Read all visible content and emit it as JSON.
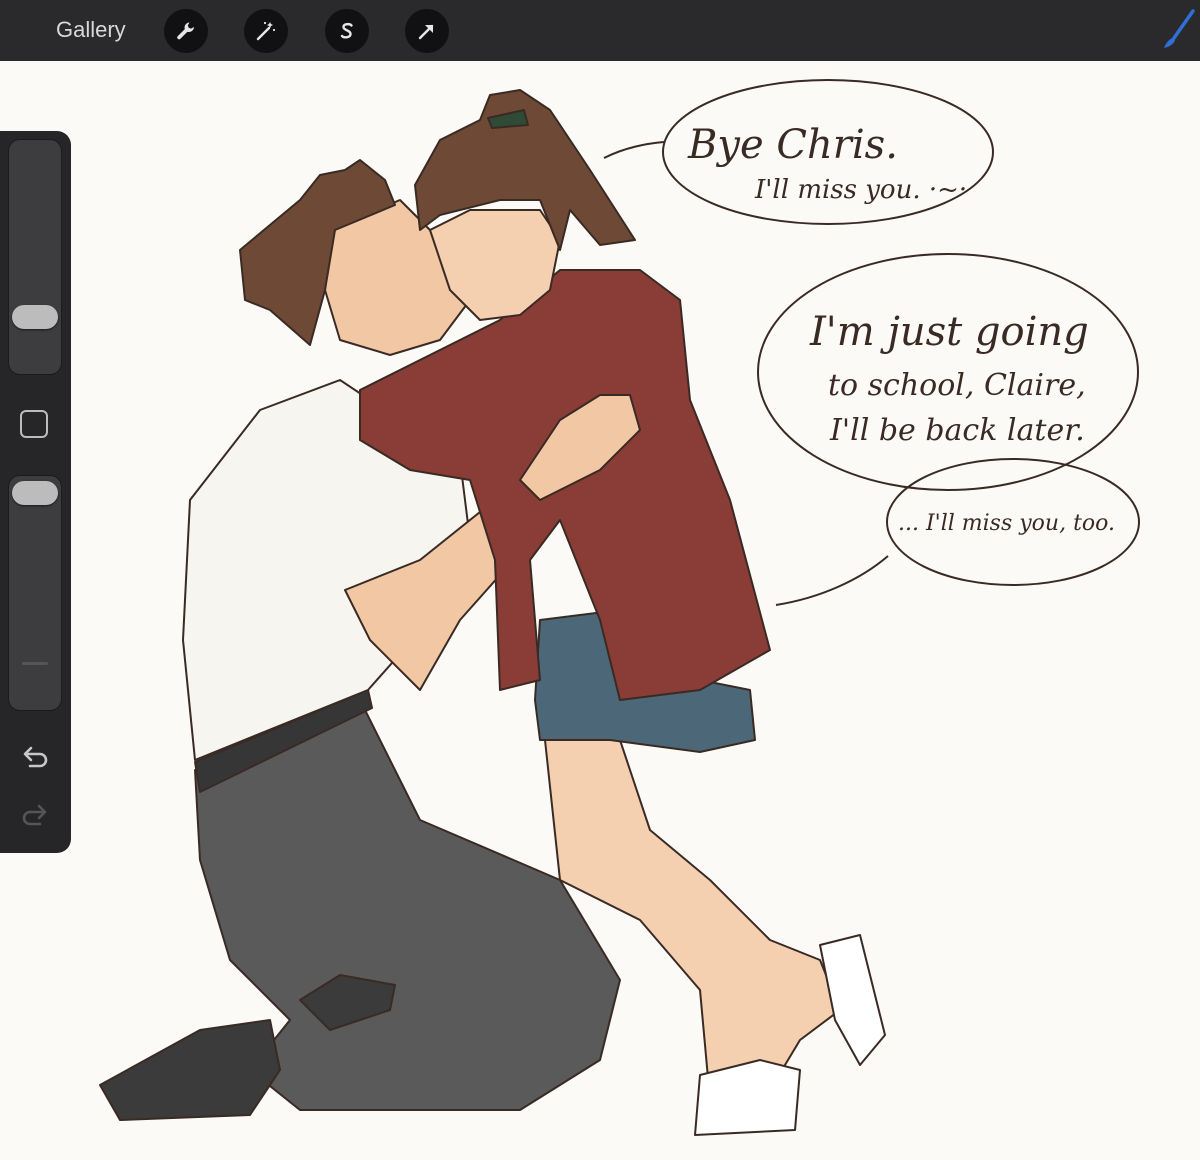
{
  "toolbar": {
    "gallery_label": "Gallery",
    "tools": [
      "wrench-icon",
      "magic-wand-icon",
      "selection-s-icon",
      "move-arrow-icon"
    ],
    "active_brush_color": "#2f6fd6"
  },
  "sidebar": {
    "brush_size_level": 0.32,
    "brush_opacity_level": 0.0,
    "controls": [
      "brush-size-slider",
      "modify-square-button",
      "brush-opacity-slider",
      "undo-button",
      "redo-button"
    ]
  },
  "artwork": {
    "speech_bubbles": [
      {
        "lines": [
          "Bye Chris.",
          "I'll miss you. ·~·"
        ]
      },
      {
        "lines": [
          "I'm just going",
          "to school, Claire,",
          "I'll be back later."
        ]
      },
      {
        "lines": [
          "... I'll miss you, too."
        ]
      }
    ]
  }
}
